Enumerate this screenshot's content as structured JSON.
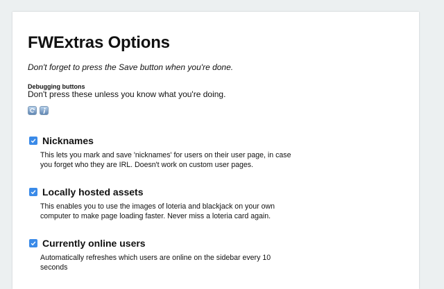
{
  "page": {
    "title": "FWExtras Options",
    "subtitle": "Don't forget to press the Save button when you're done."
  },
  "debug": {
    "heading": "Debugging buttons",
    "description": "Don't press these unless you know what you're doing.",
    "buttons": [
      {
        "icon": "refresh-icon"
      },
      {
        "icon": "info-icon"
      }
    ]
  },
  "options": [
    {
      "label": "Nicknames",
      "checked": true,
      "description": "This lets you mark and save 'nicknames' for users on their user page, in case you forget who they are IRL. Doesn't work on custom user pages."
    },
    {
      "label": "Locally hosted assets",
      "checked": true,
      "description": "This enables you to use the images of loteria and blackjack on your own computer to make page loading faster. Never miss a loteria card again."
    },
    {
      "label": "Currently online users",
      "checked": true,
      "description": "Automatically refreshes which users are online on the sidebar every 10 seconds"
    }
  ],
  "colors": {
    "background": "#ecf0f1",
    "card": "#ffffff",
    "checkbox": "#3a8ae8"
  }
}
